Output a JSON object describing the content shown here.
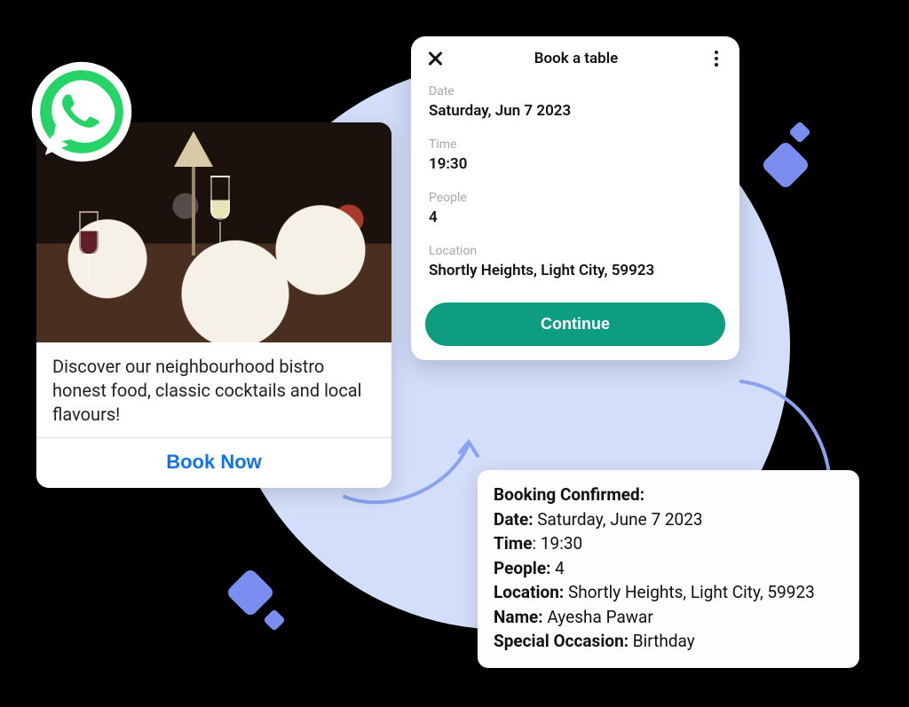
{
  "promo": {
    "description": "Discover our neighbourhood bistro honest food, classic cocktails and local flavours!",
    "cta": "Book Now"
  },
  "booking": {
    "title": "Book a table",
    "fields": {
      "date_label": "Date",
      "date_value": "Saturday, Jun 7 2023",
      "time_label": "Time",
      "time_value": "19:30",
      "people_label": "People",
      "people_value": "4",
      "location_label": "Location",
      "location_value": "Shortly Heights, Light City, 59923"
    },
    "continue": "Continue"
  },
  "confirmation": {
    "heading": "Booking Confirmed:",
    "date_label": "Date:",
    "date_value": " Saturday, June 7 2023",
    "time_label": "Time",
    "time_sep": ": ",
    "time_value": "19:30",
    "people_label": "People:",
    "people_value": " 4",
    "location_label": "Location:",
    "location_value": " Shortly Heights, Light City, 59923",
    "name_label": "Name:",
    "name_value": " Ayesha Pawar",
    "occasion_label": "Special Occasion:",
    "occasion_value": " Birthday"
  }
}
